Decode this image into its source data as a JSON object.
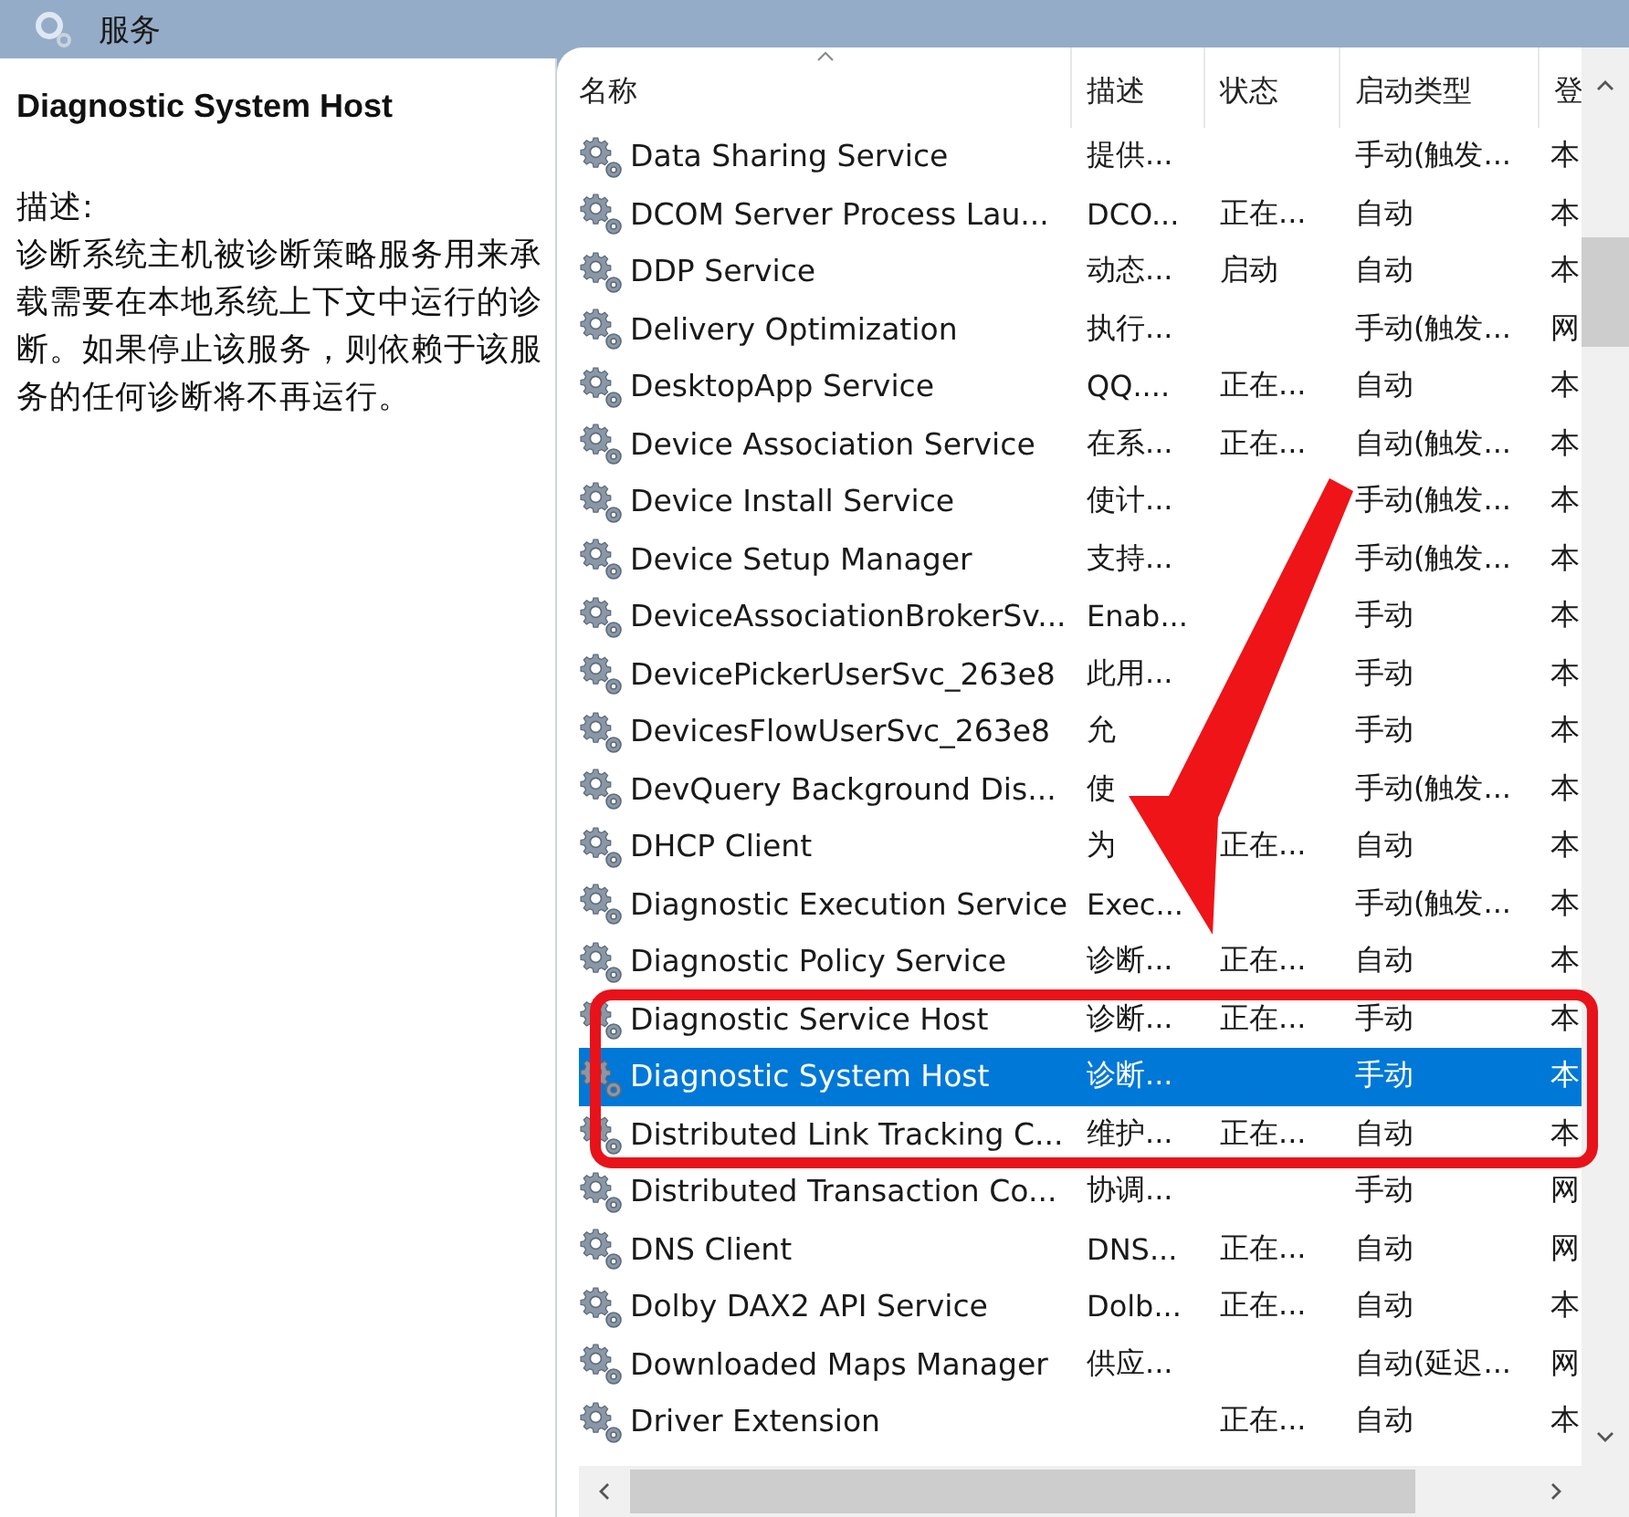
{
  "window": {
    "title": "服务"
  },
  "detail": {
    "name": "Diagnostic System Host",
    "description_label": "描述:",
    "description": "诊断系统主机被诊断策略服务用来承载需要在本地系统上下文中运行的诊断。如果停止该服务，则依赖于该服务的任何诊断将不再运行。"
  },
  "table": {
    "columns": [
      {
        "label": "名称",
        "sorted": true
      },
      {
        "label": "描述",
        "sorted": false
      },
      {
        "label": "状态",
        "sorted": false
      },
      {
        "label": "启动类型",
        "sorted": false
      },
      {
        "label": "登",
        "sorted": false
      }
    ],
    "rows": [
      {
        "name": "Data Sharing Service",
        "description": "提供...",
        "startup_type": "手动(触发...",
        "column_5": "本",
        "selected": false
      },
      {
        "name": "DCOM Server Process Lau...",
        "description": "DCO...",
        "status": "正在...",
        "startup_type": "自动",
        "column_5": "本",
        "selected": false
      },
      {
        "name": "DDP Service",
        "description": "动态...",
        "status": "启动",
        "startup_type": "自动",
        "column_5": "本",
        "selected": false
      },
      {
        "name": "Delivery Optimization",
        "description": "执行...",
        "startup_type": "手动(触发...",
        "column_5": "网",
        "selected": false
      },
      {
        "name": "DesktopApp Service",
        "description": "QQ....",
        "status": "正在...",
        "startup_type": "自动",
        "column_5": "本",
        "selected": false
      },
      {
        "name": "Device Association Service",
        "description": "在系...",
        "status": "正在...",
        "startup_type": "自动(触发...",
        "column_5": "本",
        "selected": false
      },
      {
        "name": "Device Install Service",
        "description": "使计...",
        "startup_type": "手动(触发...",
        "column_5": "本",
        "selected": false
      },
      {
        "name": "Device Setup Manager",
        "description": "支持...",
        "startup_type": "手动(触发...",
        "column_5": "本",
        "selected": false
      },
      {
        "name": "DeviceAssociationBrokerSv...",
        "description": "Enab...",
        "startup_type": "手动",
        "column_5": "本",
        "selected": false
      },
      {
        "name": "DevicePickerUserSvc_263e8",
        "description": "此用...",
        "startup_type": "手动",
        "column_5": "本",
        "selected": false
      },
      {
        "name": "DevicesFlowUserSvc_263e8",
        "description": "允",
        "startup_type": "手动",
        "column_5": "本",
        "selected": false
      },
      {
        "name": "DevQuery Background Dis...",
        "description": "使",
        "startup_type": "手动(触发...",
        "column_5": "本",
        "selected": false
      },
      {
        "name": "DHCP Client",
        "description": "为",
        "status": "正在...",
        "startup_type": "自动",
        "column_5": "本",
        "selected": false
      },
      {
        "name": "Diagnostic Execution Service",
        "description": "Exec...",
        "startup_type": "手动(触发...",
        "column_5": "本",
        "selected": false
      },
      {
        "name": "Diagnostic Policy Service",
        "description": "诊断...",
        "status": "正在...",
        "startup_type": "自动",
        "column_5": "本",
        "selected": false
      },
      {
        "name": "Diagnostic Service Host",
        "description": "诊断...",
        "status": "正在...",
        "startup_type": "手动",
        "column_5": "本",
        "selected": false
      },
      {
        "name": "Diagnostic System Host",
        "description": "诊断...",
        "startup_type": "手动",
        "column_5": "本",
        "selected": true
      },
      {
        "name": "Distributed Link Tracking C...",
        "description": "维护...",
        "status": "正在...",
        "startup_type": "自动",
        "column_5": "本",
        "selected": false
      },
      {
        "name": "Distributed Transaction Co...",
        "description": "协调...",
        "startup_type": "手动",
        "column_5": "网",
        "selected": false
      },
      {
        "name": "DNS Client",
        "description": "DNS...",
        "status": "正在...",
        "startup_type": "自动",
        "column_5": "网",
        "selected": false
      },
      {
        "name": "Dolby DAX2 API Service",
        "description": "Dolb...",
        "status": "正在...",
        "startup_type": "自动",
        "column_5": "本",
        "selected": false
      },
      {
        "name": "Downloaded Maps Manager",
        "description": "供应...",
        "startup_type": "自动(延迟...",
        "column_5": "网",
        "selected": false
      },
      {
        "name": "Driver Extension",
        "status": "正在...",
        "startup_type": "自动",
        "column_5": "本",
        "selected": false
      }
    ]
  }
}
